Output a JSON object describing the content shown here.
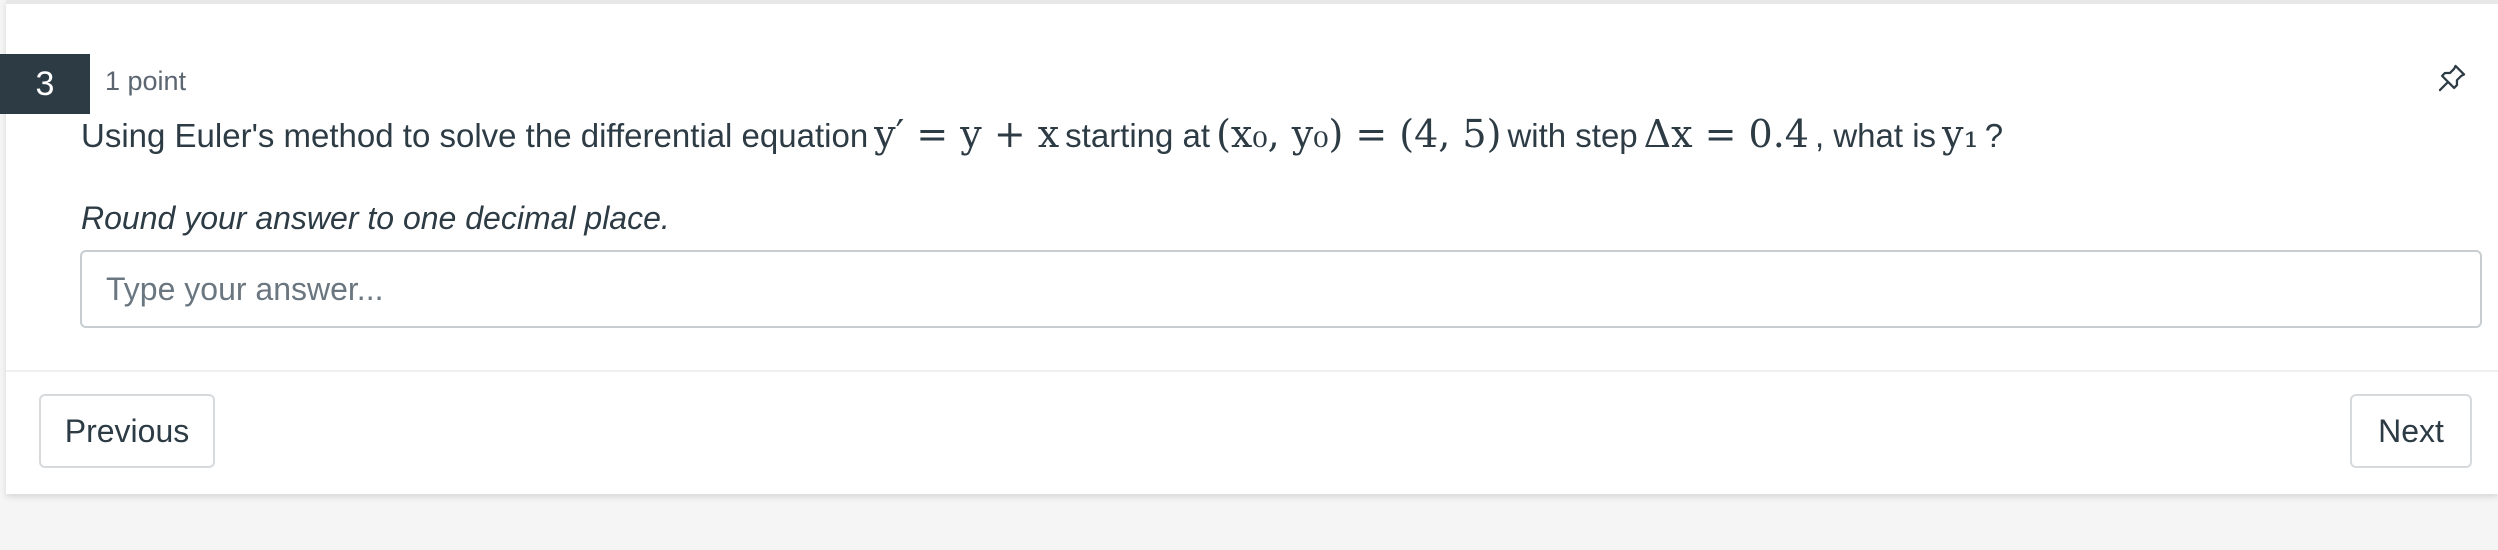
{
  "question": {
    "number": "3",
    "points": "1 point",
    "text_before_eq": "Using Euler's method to solve the differential equation",
    "equation": "y′ = y + x",
    "text_starting": "starting at",
    "initial_condition": "(x₀, y₀) = (4, 5)",
    "text_step": "with step",
    "step": "Δx = 0.4",
    "text_what": ", what is",
    "target": "y₁",
    "text_end": "?",
    "instruction": "Round your answer to one decimal place."
  },
  "answer": {
    "placeholder": "Type your answer..."
  },
  "nav": {
    "previous_label": "Previous",
    "next_label": "Next"
  },
  "icons": {
    "pin": "pin-icon"
  }
}
